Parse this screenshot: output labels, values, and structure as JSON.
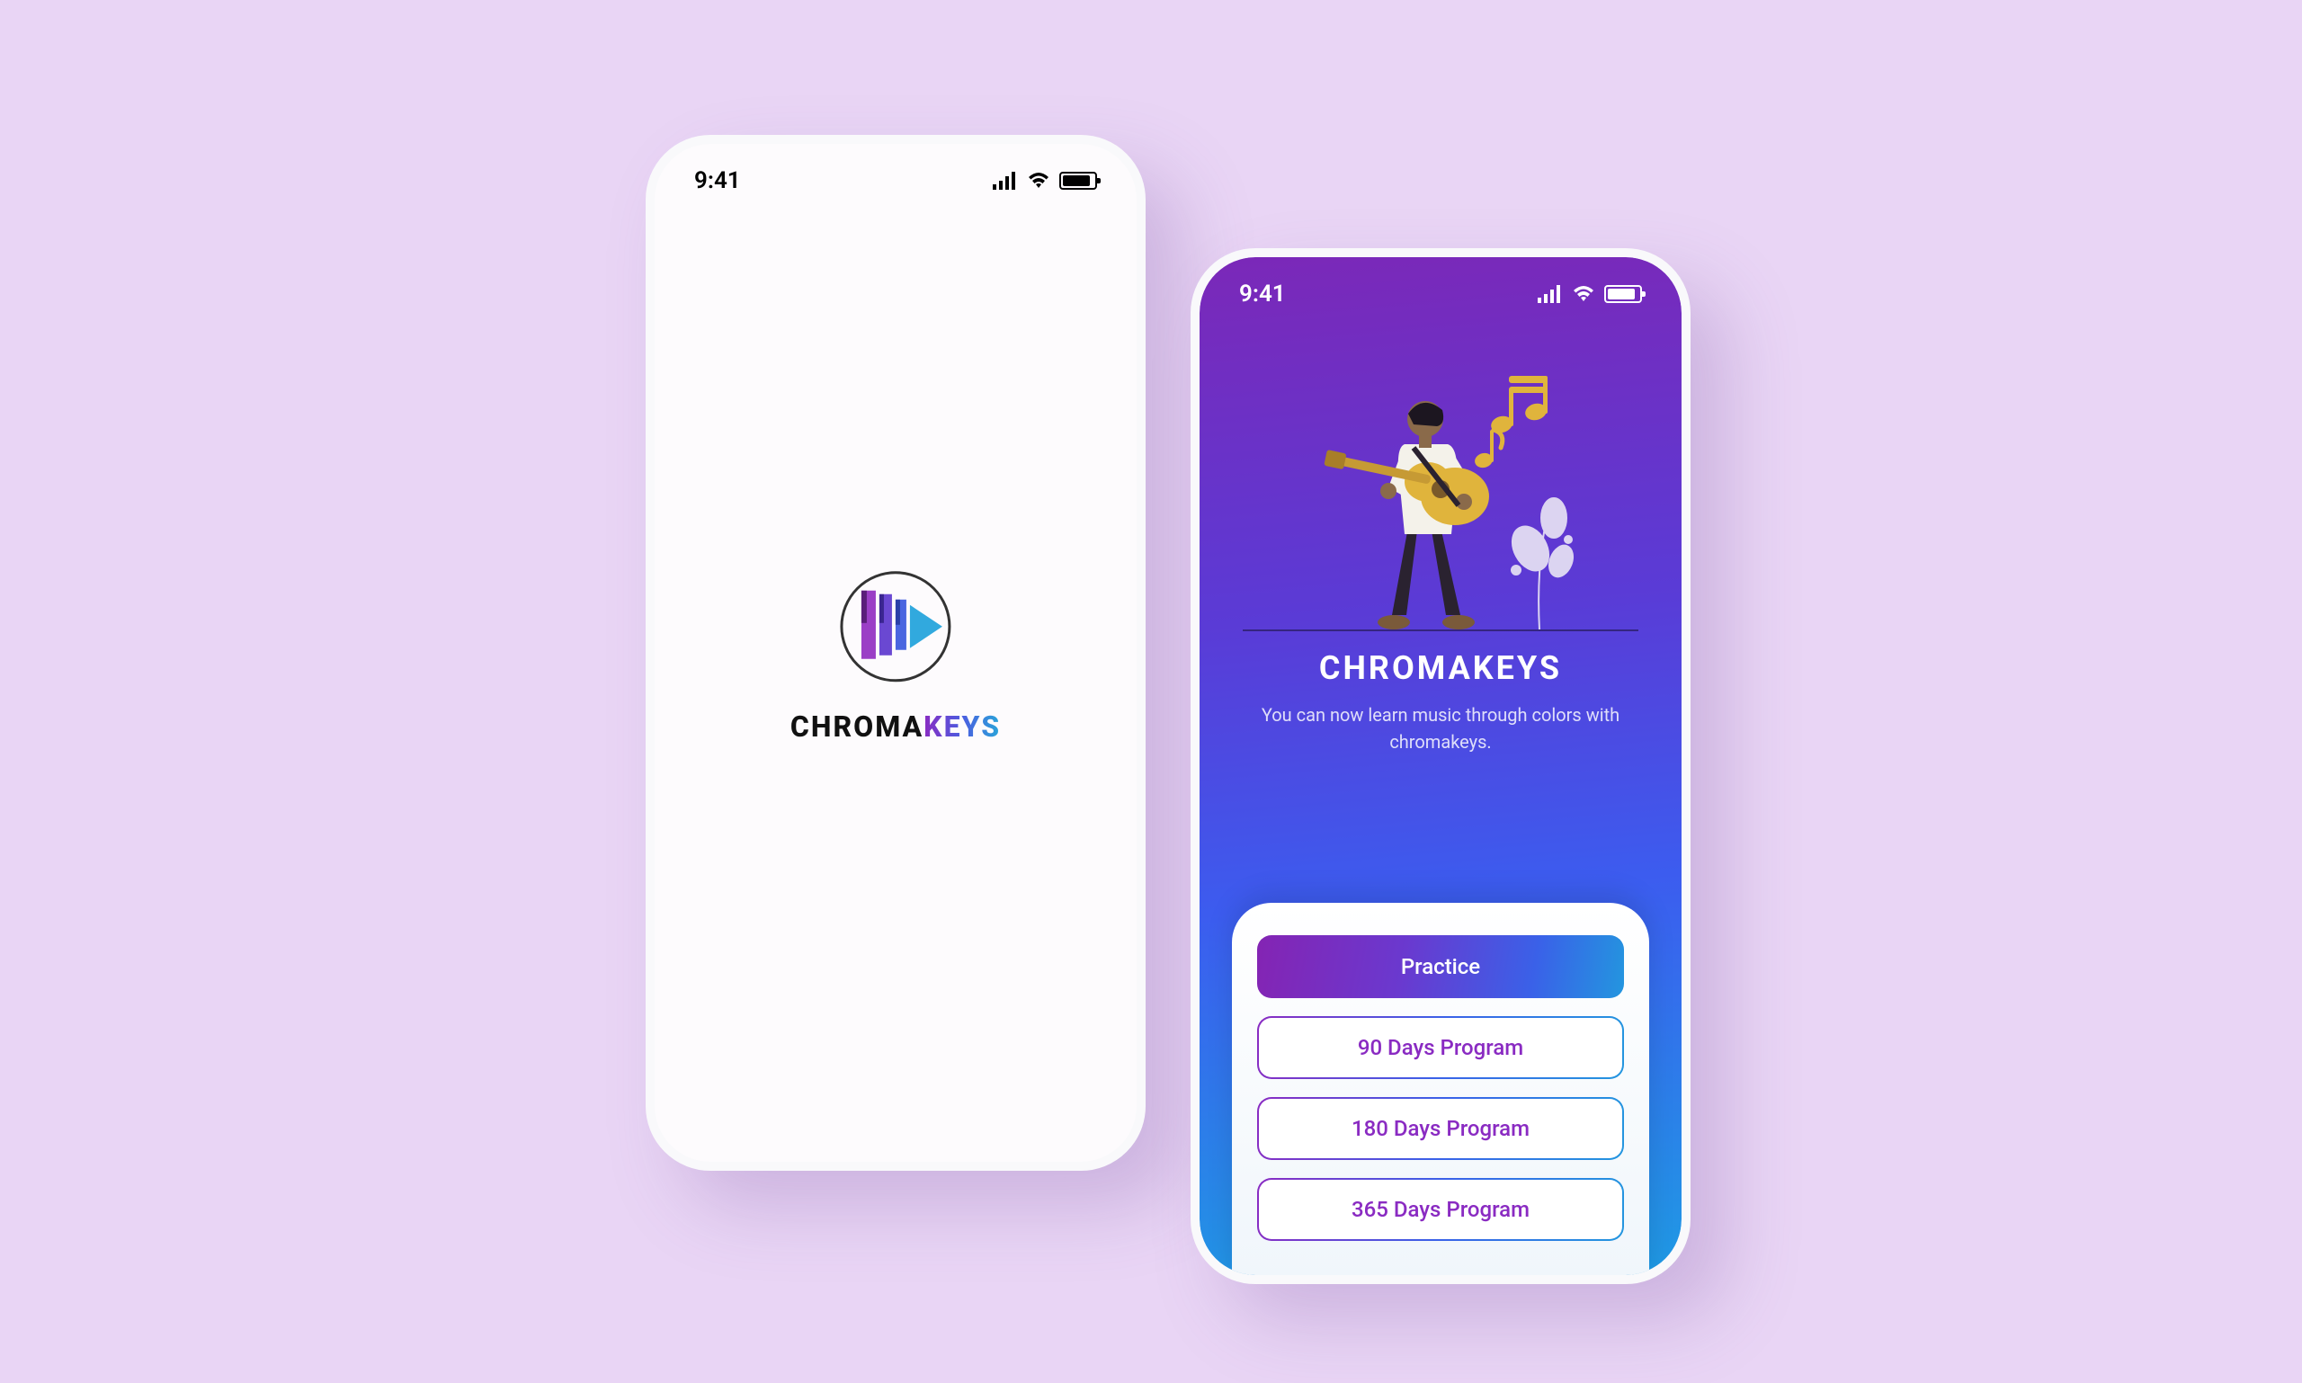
{
  "status": {
    "time": "9:41"
  },
  "splash": {
    "logo_chroma": "CHROMA",
    "logo_keys": "KEYS"
  },
  "home": {
    "title": "CHROMAKEYS",
    "subtitle": "You can now learn music through colors with chromakeys.",
    "buttons": {
      "practice": "Practice",
      "program90": "90 Days Program",
      "program180": "180 Days Program",
      "program365": "365 Days Program"
    }
  },
  "colors": {
    "purple": "#8a2bc2",
    "blue": "#3a61e8",
    "cyan": "#2396df",
    "gold": "#e0b43c"
  }
}
